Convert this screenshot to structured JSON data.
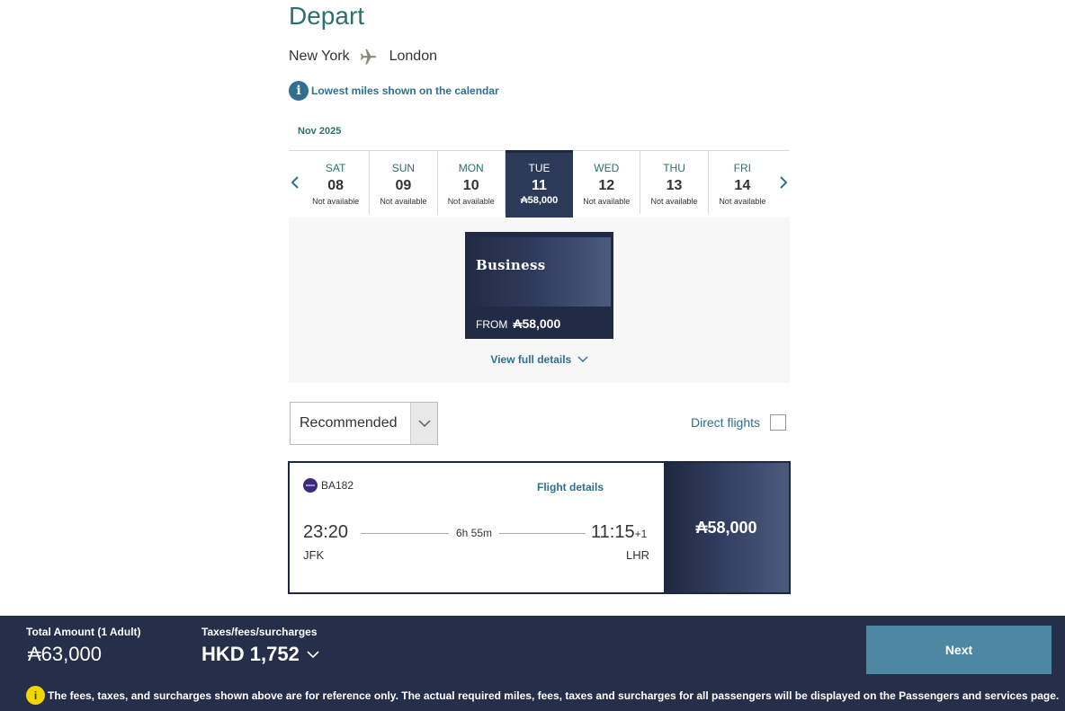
{
  "header": {
    "title": "Depart",
    "origin": "New York",
    "destination": "London",
    "info_text": "Lowest miles shown on the calendar"
  },
  "calendar": {
    "month": "Nov 2025",
    "days": [
      {
        "dow": "SAT",
        "date": "08",
        "status": "Not available",
        "selected": false
      },
      {
        "dow": "SUN",
        "date": "09",
        "status": "Not available",
        "selected": false
      },
      {
        "dow": "MON",
        "date": "10",
        "status": "Not available",
        "selected": false
      },
      {
        "dow": "TUE",
        "date": "11",
        "status": "₳58,000",
        "selected": true
      },
      {
        "dow": "WED",
        "date": "12",
        "status": "Not available",
        "selected": false
      },
      {
        "dow": "THU",
        "date": "13",
        "status": "Not available",
        "selected": false
      },
      {
        "dow": "FRI",
        "date": "14",
        "status": "Not available",
        "selected": false
      }
    ]
  },
  "cabin": {
    "name": "Business",
    "from_label": "FROM",
    "price": "₳58,000",
    "view_details": "View full details"
  },
  "filters": {
    "sort_label": "Recommended",
    "direct_label": "Direct flights",
    "direct_checked": false
  },
  "flight": {
    "number": "BA182",
    "details_link": "Flight details",
    "dep_time": "23:20",
    "dep_code": "JFK",
    "duration": "6h 55m",
    "arr_time": "11:15",
    "arr_day_offset": "+1",
    "arr_code": "LHR",
    "price": "₳58,000"
  },
  "footer": {
    "total_label": "Total Amount (1 Adult)",
    "total_value": "₳63,000",
    "tax_label": "Taxes/fees/surcharges",
    "tax_value": "HKD 1,752",
    "next_label": "Next",
    "notice": "The fees, taxes, and surcharges shown above are for reference only. The actual required miles, fees, taxes and surcharges for all passengers will be displayed on the Passengers and services page."
  },
  "colors": {
    "accent_teal": "#2f6f6d",
    "link_blue": "#2f6f8f",
    "navy": "#252f49",
    "button_blue": "#4d87a3",
    "warning_yellow": "#f2d600"
  }
}
